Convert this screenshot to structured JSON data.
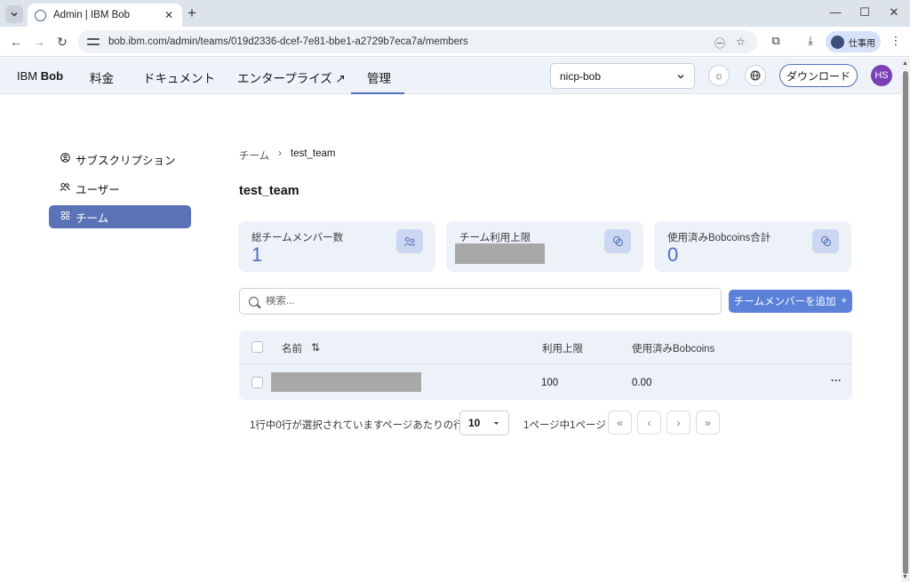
{
  "browser": {
    "tab_title": "Admin | IBM Bob",
    "url": "bob.ibm.com/admin/teams/019d2336-dcef-7e81-bbe1-a2729b7eca7a/members",
    "profile_label": "仕事用"
  },
  "header": {
    "brand_prefix": "IBM",
    "brand_name": "Bob",
    "nav": [
      "料金",
      "ドキュメント",
      "エンタープライズ ↗",
      "管理"
    ],
    "active_nav": "管理",
    "org_select": "nicp-bob",
    "download_label": "ダウンロード",
    "avatar_initials": "HS"
  },
  "sidebar": {
    "items": [
      {
        "label": "サブスクリプション",
        "icon": "user-circle-icon"
      },
      {
        "label": "ユーザー",
        "icon": "users-icon"
      },
      {
        "label": "チーム",
        "icon": "team-icon",
        "active": true
      }
    ]
  },
  "breadcrumb": {
    "parent": "チーム",
    "current": "test_team"
  },
  "page_title": "test_team",
  "cards": [
    {
      "label": "総チームメンバー数",
      "value": "1",
      "icon": "users-icon"
    },
    {
      "label": "チーム利用上限",
      "value": "",
      "icon": "coins-icon",
      "redacted": true
    },
    {
      "label": "使用済みBobcoins合計",
      "value": "0",
      "icon": "coins-icon"
    }
  ],
  "search": {
    "placeholder": "検索..."
  },
  "add_member_label": "チームメンバーを追加",
  "add_member_plus": "+",
  "table": {
    "columns": [
      "名前",
      "利用上限",
      "使用済みBobcoins"
    ],
    "rows": [
      {
        "name": "",
        "name_redacted": true,
        "limit": "100",
        "used": "0.00"
      }
    ]
  },
  "pagination": {
    "selection_text": "1行中0行が選択されています",
    "rows_per_page_label": "ページあたりの行数",
    "rows_per_page": "10",
    "page_text": "1ページ中1ページ"
  },
  "colors": {
    "accent": "#4f6ebf",
    "active_sidebar": "#5b73b6",
    "add_button": "#5b81d8",
    "card_bg": "#edf1f8",
    "avatar": "#7b3fb8"
  }
}
